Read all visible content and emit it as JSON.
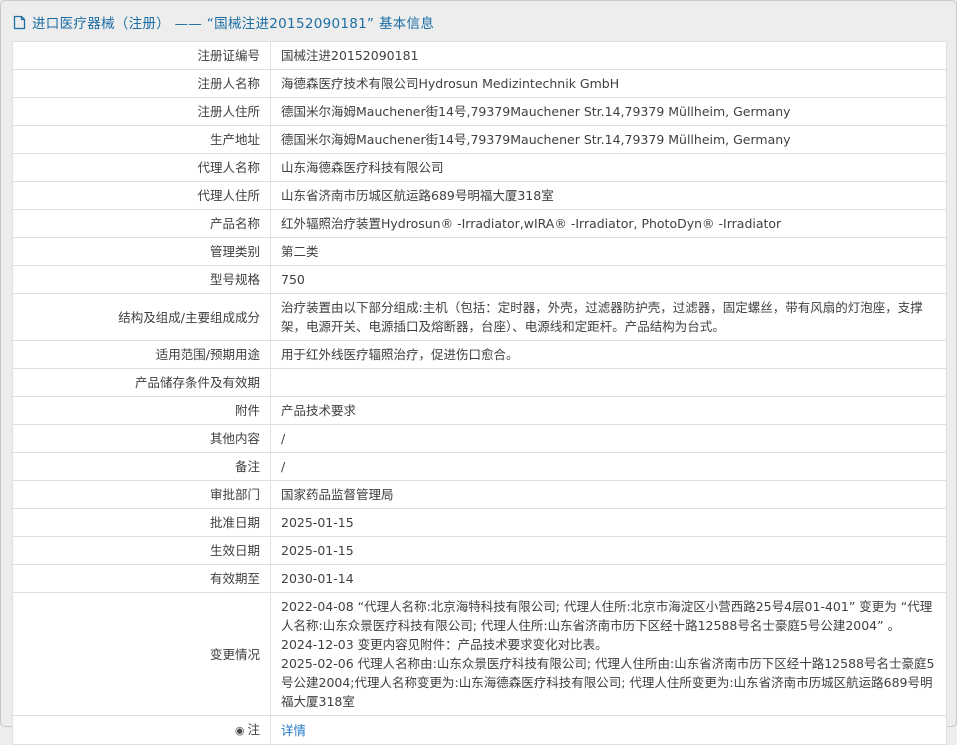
{
  "colors": {
    "title": "#1c6ea4",
    "link": "#2478c8",
    "border": "#e0e0e0",
    "page_background": "#ededed"
  },
  "header": {
    "icon": "document-icon",
    "title": "进口医疗器械（注册） ——  “国械注进20152090181”  基本信息"
  },
  "table": {
    "rows": [
      {
        "label": "注册证编号",
        "value": "国械注进20152090181"
      },
      {
        "label": "注册人名称",
        "value": "海德森医疗技术有限公司Hydrosun Medizintechnik GmbH"
      },
      {
        "label": "注册人住所",
        "value": "德国米尔海姆Mauchener街14号,79379Mauchener Str.14,79379 Müllheim, Germany"
      },
      {
        "label": "生产地址",
        "value": "德国米尔海姆Mauchener街14号,79379Mauchener Str.14,79379 Müllheim, Germany"
      },
      {
        "label": "代理人名称",
        "value": "山东海德森医疗科技有限公司"
      },
      {
        "label": "代理人住所",
        "value": "山东省济南市历城区航运路689号明福大厦318室"
      },
      {
        "label": "产品名称",
        "value": "红外辐照治疗装置Hydrosun® -Irradiator,wIRA® -Irradiator, PhotoDyn® -Irradiator"
      },
      {
        "label": "管理类别",
        "value": "第二类"
      },
      {
        "label": "型号规格",
        "value": "750"
      },
      {
        "label": "结构及组成/主要组成成分",
        "value": "治疗装置由以下部分组成:主机（包括：定时器，外壳，过滤器防护壳，过滤器，固定螺丝，带有风扇的灯泡座，支撑架，电源开关、电源插口及熔断器，台座）、电源线和定距杆。产品结构为台式。"
      },
      {
        "label": "适用范围/预期用途",
        "value": "用于红外线医疗辐照治疗，促进伤口愈合。"
      },
      {
        "label": "产品储存条件及有效期",
        "value": ""
      },
      {
        "label": "附件",
        "value": "产品技术要求"
      },
      {
        "label": "其他内容",
        "value": "/"
      },
      {
        "label": "备注",
        "value": "/"
      },
      {
        "label": "审批部门",
        "value": "国家药品监督管理局"
      },
      {
        "label": "批准日期",
        "value": "2025-01-15"
      },
      {
        "label": "生效日期",
        "value": "2025-01-15"
      },
      {
        "label": "有效期至",
        "value": "2030-01-14"
      },
      {
        "label": "变更情况",
        "value": [
          "2022-04-08  “代理人名称:北京海特科技有限公司; 代理人住所:北京市海淀区小营西路25号4层01-401”  变更为  “代理人名称:山东众景医疗科技有限公司; 代理人住所:山东省济南市历下区经十路12588号名士豪庭5号公建2004” 。",
          "2024-12-03 变更内容见附件：产品技术要求变化对比表。",
          "2025-02-06 代理人名称由:山东众景医疗科技有限公司; 代理人住所由:山东省济南市历下区经十路12588号名士豪庭5号公建2004;代理人名称变更为:山东海德森医疗科技有限公司; 代理人住所变更为:山东省济南市历城区航运路689号明福大厦318室"
        ]
      },
      {
        "label": "注",
        "label_icon": "◉",
        "value": "详情",
        "link": true
      }
    ]
  }
}
